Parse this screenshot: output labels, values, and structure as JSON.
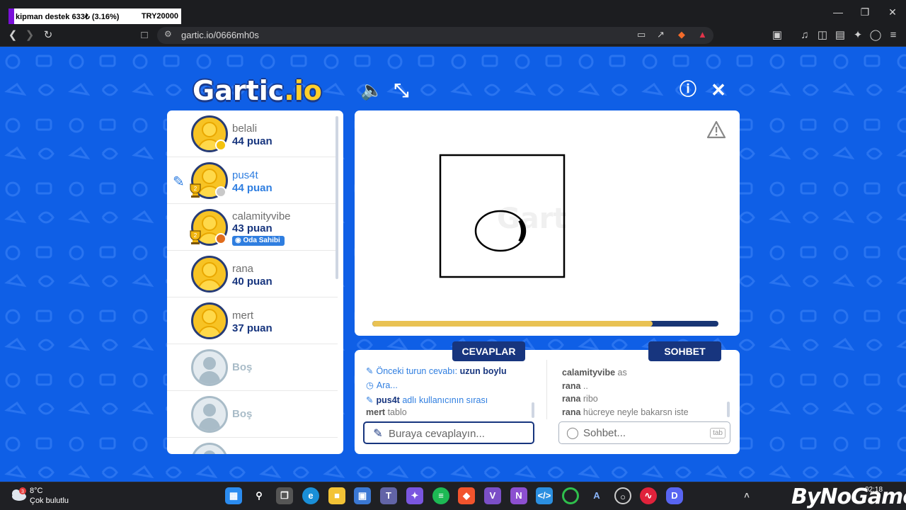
{
  "donation": {
    "text": "kipman destek  633₺ (3.16%)",
    "goal": "TRY20000",
    "color": "#7a10d9"
  },
  "browser": {
    "url": "gartic.io/0666mh0s"
  },
  "game": {
    "logo_main": "Gartic",
    "logo_suffix": ".io",
    "players": [
      {
        "name": "belali",
        "score": "44 puan",
        "status_color": "#f4c20d",
        "drawing": false,
        "trophy": false,
        "owner": false
      },
      {
        "name": "pus4t",
        "score": "44 puan",
        "status_color": "#c9c9c9",
        "drawing": true,
        "trophy": true,
        "trophy_rank": "2",
        "owner": false
      },
      {
        "name": "calamityvibe",
        "score": "43 puan",
        "status_color": "#e06c1c",
        "drawing": false,
        "trophy": true,
        "trophy_rank": "2",
        "owner": true,
        "owner_label": "Oda Sahibi"
      },
      {
        "name": "rana",
        "score": "40 puan",
        "status_color": "",
        "drawing": false,
        "trophy": false,
        "owner": false
      },
      {
        "name": "mert",
        "score": "37 puan",
        "status_color": "",
        "drawing": false,
        "trophy": false,
        "owner": false
      },
      {
        "name": "Boş",
        "empty": true
      },
      {
        "name": "Boş",
        "empty": true
      }
    ],
    "timer_progress": 0.81,
    "colors": {
      "background": "#0f5fe6",
      "navy": "#17357e",
      "accent_blue": "#2f7ee0",
      "timer": "#e9c253"
    },
    "answers": {
      "tab_label": "CEVAPLAR",
      "previous_answer_prefix": "Önceki turun cevabı:",
      "previous_answer": "uzun boylu",
      "waiting": "Ara...",
      "turn_user": "pus4t",
      "turn_text": "adlı kullanıcının sırası",
      "last_user": "mert",
      "last_guess": "tablo",
      "placeholder": "Buraya cevaplayın..."
    },
    "chat": {
      "tab_label": "SOHBET",
      "messages": [
        {
          "user": "calamityvibe",
          "text": "as"
        },
        {
          "user": "rana",
          "text": ".."
        },
        {
          "user": "rana",
          "text": "ribo"
        },
        {
          "user": "rana",
          "text": "hücreye neyle bakarsn iste"
        }
      ],
      "placeholder": "Sohbet...",
      "tab_key": "tab"
    }
  },
  "taskbar": {
    "temperature": "8°C",
    "weather": "Çok bulutlu",
    "weather_badge": "3",
    "brand": "ByNoGame",
    "time": "02:18"
  }
}
